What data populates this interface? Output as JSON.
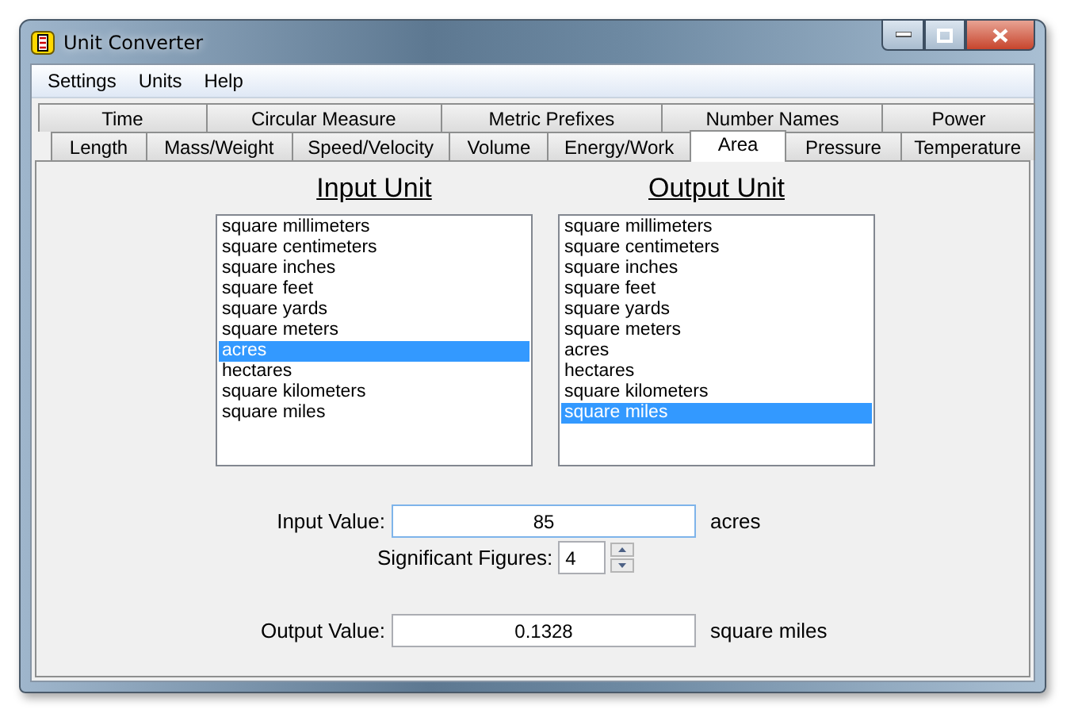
{
  "window": {
    "title": "Unit Converter"
  },
  "menu": [
    "Settings",
    "Units",
    "Help"
  ],
  "tab_rows": [
    [
      {
        "label": "Time",
        "selected": false
      },
      {
        "label": "Circular Measure",
        "selected": false
      },
      {
        "label": "Metric Prefixes",
        "selected": false
      },
      {
        "label": "Number Names",
        "selected": false
      },
      {
        "label": "Power",
        "selected": false
      }
    ],
    [
      {
        "label": "Length",
        "selected": false
      },
      {
        "label": "Mass/Weight",
        "selected": false
      },
      {
        "label": "Speed/Velocity",
        "selected": false
      },
      {
        "label": "Volume",
        "selected": false
      },
      {
        "label": "Energy/Work",
        "selected": false
      },
      {
        "label": "Area",
        "selected": true
      },
      {
        "label": "Pressure",
        "selected": false
      },
      {
        "label": "Temperature",
        "selected": false
      }
    ]
  ],
  "unit_lists": [
    {
      "heading": "Input Unit",
      "items": [
        {
          "label": "square millimeters",
          "selected": false
        },
        {
          "label": "square centimeters",
          "selected": false
        },
        {
          "label": "square inches",
          "selected": false
        },
        {
          "label": "square feet",
          "selected": false
        },
        {
          "label": "square yards",
          "selected": false
        },
        {
          "label": "square meters",
          "selected": false
        },
        {
          "label": "acres",
          "selected": true
        },
        {
          "label": "hectares",
          "selected": false
        },
        {
          "label": "square kilometers",
          "selected": false
        },
        {
          "label": "square miles",
          "selected": false
        }
      ]
    },
    {
      "heading": "Output Unit",
      "items": [
        {
          "label": "square millimeters",
          "selected": false
        },
        {
          "label": "square centimeters",
          "selected": false
        },
        {
          "label": "square inches",
          "selected": false
        },
        {
          "label": "square feet",
          "selected": false
        },
        {
          "label": "square yards",
          "selected": false
        },
        {
          "label": "square meters",
          "selected": false
        },
        {
          "label": "acres",
          "selected": false
        },
        {
          "label": "hectares",
          "selected": false
        },
        {
          "label": "square kilometers",
          "selected": false
        },
        {
          "label": "square miles",
          "selected": true
        }
      ]
    }
  ],
  "input_value": {
    "label": "Input Value:",
    "value": "85",
    "unit": "acres"
  },
  "significant_figures": {
    "label": "Significant Figures:",
    "value": "4"
  },
  "output_value": {
    "label": "Output Value:",
    "value": "0.1328",
    "unit": "square miles"
  }
}
